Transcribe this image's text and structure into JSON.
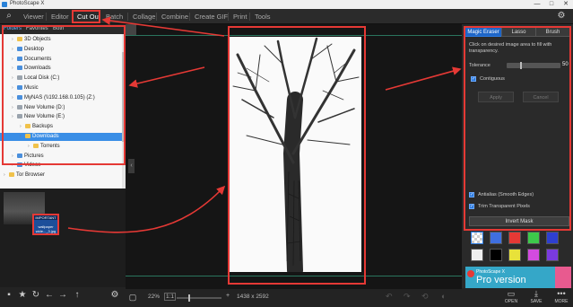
{
  "window": {
    "title": "PhotoScape X",
    "controls": [
      "—",
      "□",
      "✕"
    ]
  },
  "menu": [
    "Viewer",
    "Editor",
    "Cut Out",
    "Batch",
    "Collage",
    "Combine",
    "Create GIF",
    "Print",
    "Tools"
  ],
  "menu_active": "Cut Out",
  "folder_tabs": [
    "Folders",
    "Favorites",
    "Both"
  ],
  "tree": [
    {
      "label": "3D Objects",
      "depth": 1,
      "icon": "folder-icon"
    },
    {
      "label": "Desktop",
      "depth": 1,
      "icon": "desktop-icon"
    },
    {
      "label": "Documents",
      "depth": 1,
      "icon": "documents-icon"
    },
    {
      "label": "Downloads",
      "depth": 1,
      "icon": "download-icon"
    },
    {
      "label": "Local Disk (C:)",
      "depth": 1,
      "icon": "disk-icon"
    },
    {
      "label": "Music",
      "depth": 1,
      "icon": "music-icon"
    },
    {
      "label": "MyNAS (\\\\192.168.0.105) (Z:)",
      "depth": 1,
      "icon": "network-drive-icon"
    },
    {
      "label": "New Volume (D:)",
      "depth": 1,
      "icon": "disk-icon"
    },
    {
      "label": "New Volume (E:)",
      "depth": 1,
      "icon": "disk-icon"
    },
    {
      "label": "Backups",
      "depth": 2,
      "icon": "folder-icon"
    },
    {
      "label": "Downloads",
      "depth": 2,
      "icon": "folder-icon",
      "selected": true
    },
    {
      "label": "Torrents",
      "depth": 3,
      "icon": "folder-icon"
    },
    {
      "label": "Pictures",
      "depth": 1,
      "icon": "pictures-icon"
    },
    {
      "label": "Videos",
      "depth": 1,
      "icon": "videos-icon"
    },
    {
      "label": "Tor Browser",
      "depth": 0,
      "icon": "folder-icon"
    }
  ],
  "file_thumb": {
    "label": "wallpaper wide..._3.jpg",
    "thumb_text": "IMPORTANT"
  },
  "status": {
    "zoom": "22%",
    "ratio": "1:1",
    "dimensions": "1438 x 2592"
  },
  "tools": {
    "tabs": [
      "Magic Eraser",
      "Lasso",
      "Brush"
    ],
    "active": "Magic Eraser",
    "hint": "Click on desired image area to fill with transparency.",
    "tolerance_label": "Tolerance",
    "tolerance_value": "50",
    "contiguous": "Contiguous",
    "apply": "Apply",
    "cancel": "Cancel",
    "antialias": "Antialias (Smooth Edges)",
    "trim": "Trim Transparent Pixels",
    "invert": "Invert Mask"
  },
  "swatches": [
    "checker",
    "#3f6fe0",
    "#e53935",
    "#3dc94b",
    "#2e3fd0",
    "#f0f0f0",
    "#000000",
    "#e8e23a",
    "#d34be0",
    "#7a3ae0"
  ],
  "ad": {
    "line1": "PhotoScape X",
    "line2": "Pro version"
  },
  "right_actions": [
    "OPEN",
    "SAVE",
    "MORE"
  ],
  "colors": {
    "accent": "#1e66c8",
    "annotation": "#e53935",
    "guide": "#39b58e"
  }
}
